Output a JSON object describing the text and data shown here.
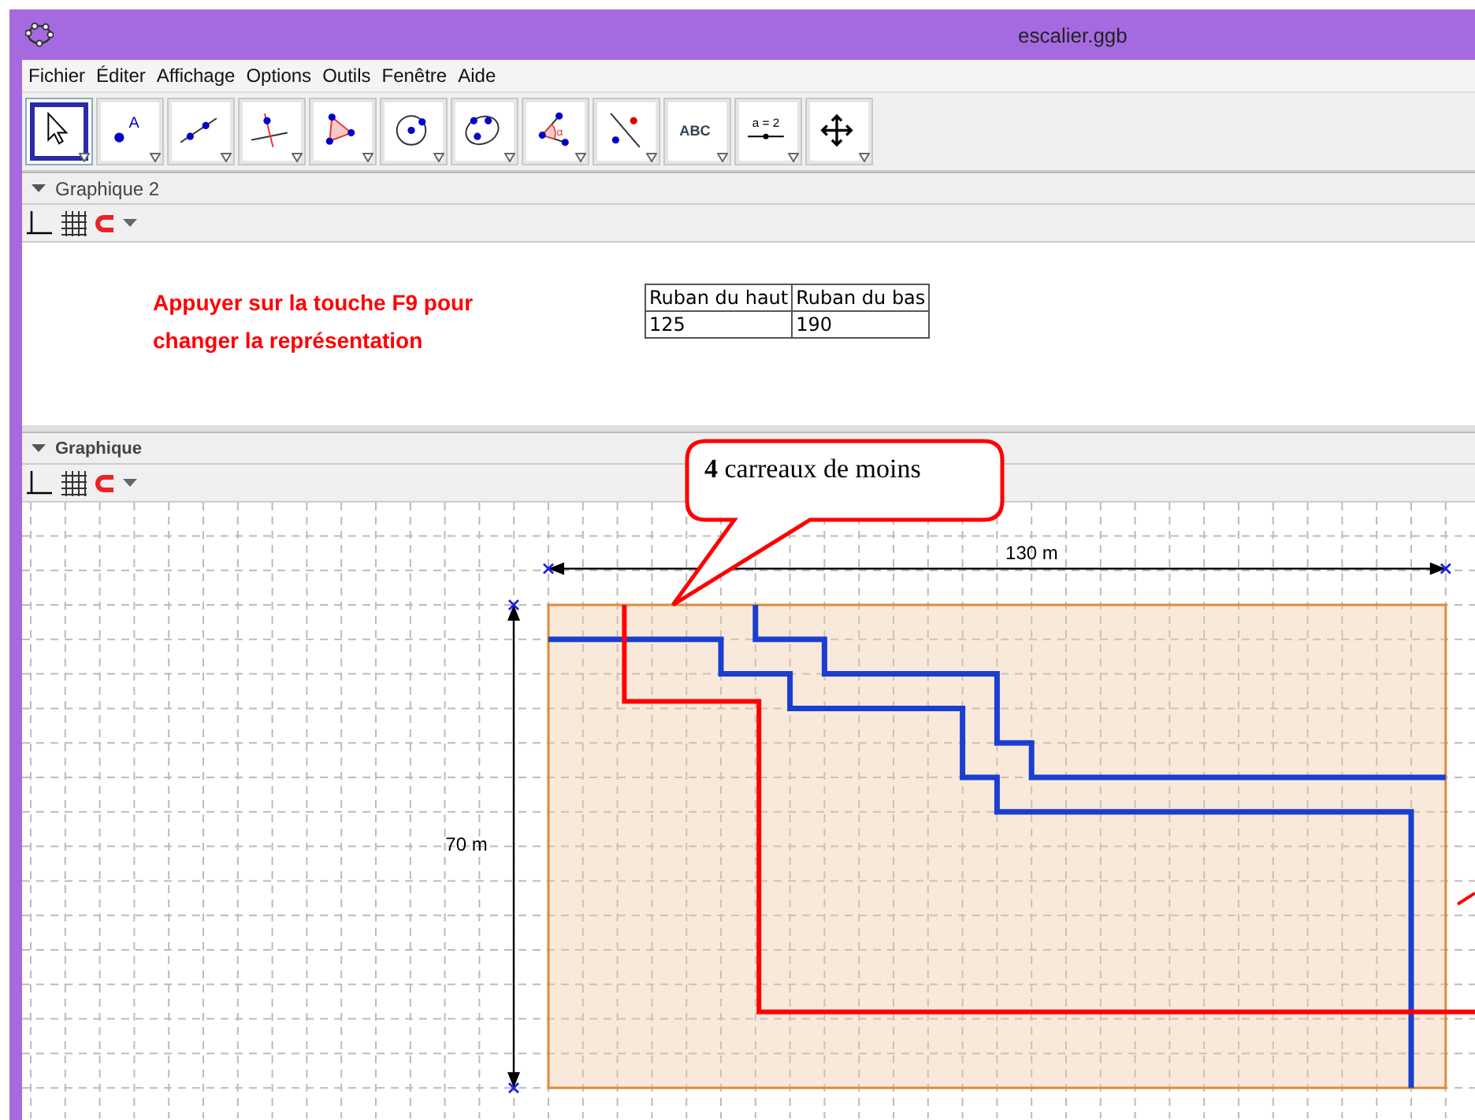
{
  "window": {
    "title": "escalier.ggb"
  },
  "menu": [
    "Fichier",
    "Éditer",
    "Affichage",
    "Options",
    "Outils",
    "Fenêtre",
    "Aide"
  ],
  "tools": [
    {
      "kind": "pointer",
      "selected": true
    },
    {
      "kind": "point",
      "label": "A",
      "selected": false
    },
    {
      "kind": "line",
      "selected": false
    },
    {
      "kind": "perpendicular",
      "selected": false
    },
    {
      "kind": "polygon",
      "selected": false
    },
    {
      "kind": "circle",
      "selected": false
    },
    {
      "kind": "conic",
      "selected": false
    },
    {
      "kind": "angle",
      "label": "α",
      "selected": false
    },
    {
      "kind": "reflect",
      "selected": false
    },
    {
      "kind": "text",
      "label": "ABC",
      "selected": false
    },
    {
      "kind": "slider",
      "label": "a = 2",
      "selected": false
    },
    {
      "kind": "move",
      "selected": false
    }
  ],
  "graphics2": {
    "title": "Graphique 2",
    "note": "Appuyer sur la touche F9 pour changer la représentation",
    "table": {
      "columns": [
        "Ruban du haut",
        "Ruban du bas"
      ],
      "rows": [
        [
          "125",
          "190"
        ]
      ]
    }
  },
  "graphics": {
    "title": "Graphique",
    "width_label": "130 m",
    "height_label": "70 m",
    "callout": "**4** carreaux de moins"
  }
}
